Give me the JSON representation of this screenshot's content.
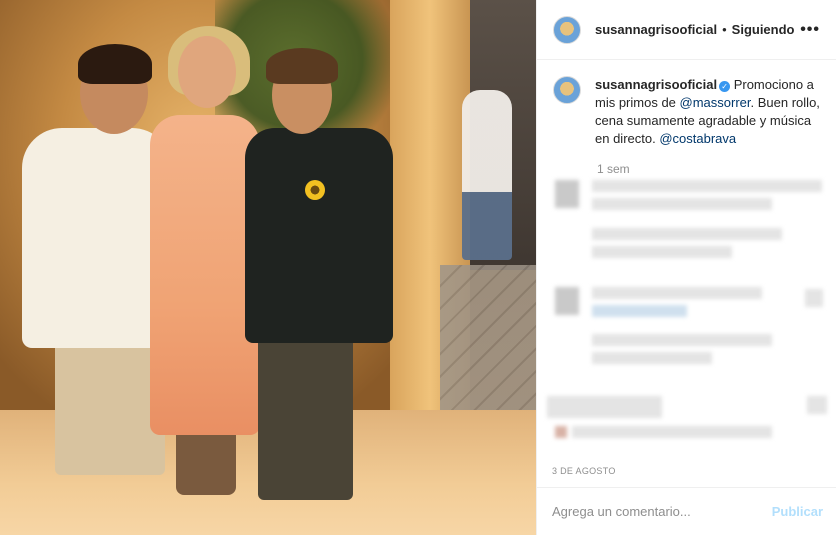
{
  "post": {
    "photo_alt": "photo",
    "username": "susannagrisooficial",
    "follow_separator": "•",
    "follow_label": "Siguiendo",
    "more_icon": "more-horizontal-icon",
    "caption": {
      "username": "susannagrisooficial",
      "verified_icon": "verified-badge-icon",
      "text_before": " Promociono a mis primos de ",
      "mention1": "@massorrer",
      "text_middle": ". Buen rollo, cena sumamente agradable y música en directo. ",
      "mention2": "@costabrava"
    },
    "time_ago": "1 sem",
    "date": "3 DE AGOSTO",
    "comment": {
      "placeholder": "Agrega un comentario...",
      "value": "",
      "publish_label": "Publicar"
    }
  },
  "colors": {
    "accent": "#3897f0",
    "mention": "#00376b",
    "publish_disabled": "#b2dffc",
    "muted": "#8e8e8e"
  }
}
